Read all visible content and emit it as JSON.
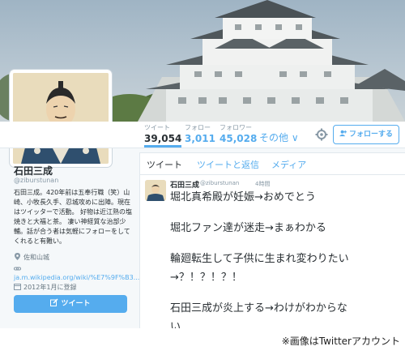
{
  "profile_nav": {
    "stats": [
      {
        "label": "ツイート",
        "value": "39,054"
      },
      {
        "label": "フォロー",
        "value": "3,011"
      },
      {
        "label": "フォロワー",
        "value": "45,028"
      }
    ],
    "more_label": "その他 ∨",
    "follow_button": "フォローする"
  },
  "profile": {
    "name": "石田三成",
    "handle": "@ziburstunan",
    "bio": "石田三成。420年前は五奉行職（笑）山崎、小牧長久手、忍城攻めに出陣。現在はツイッターで活動。 好物は近江熟の塩焼きと大福と茶。 凄い神経質な治部少輔。話が合う者は気軽にフォローをしてくれると有難い。",
    "location": "佐和山城",
    "link": "ja.m.wikipedia.org/wiki/%E7%9F%B3...",
    "joined": "2012年1月に登録",
    "tweet_button": "ツイート"
  },
  "timeline": {
    "tabs": [
      "ツイート",
      "ツイートと返信",
      "メディア"
    ],
    "tweet": {
      "name": "石田三成",
      "handle": "@ziburstunan",
      "time": "4時間",
      "lines": [
        "堀北真希殿が妊娠→おめでとう",
        "堀北ファン達が迷走→まぁわかる",
        "輪廻転生して子供に生まれ変わりたい",
        "→？！？！？！",
        "石田三成が炎上する→わけがわからな",
        "い"
      ]
    }
  },
  "caption": "※画像はTwitterアカウント",
  "colors": {
    "accent": "#55acee",
    "text": "#292f33",
    "muted": "#8899a6"
  }
}
